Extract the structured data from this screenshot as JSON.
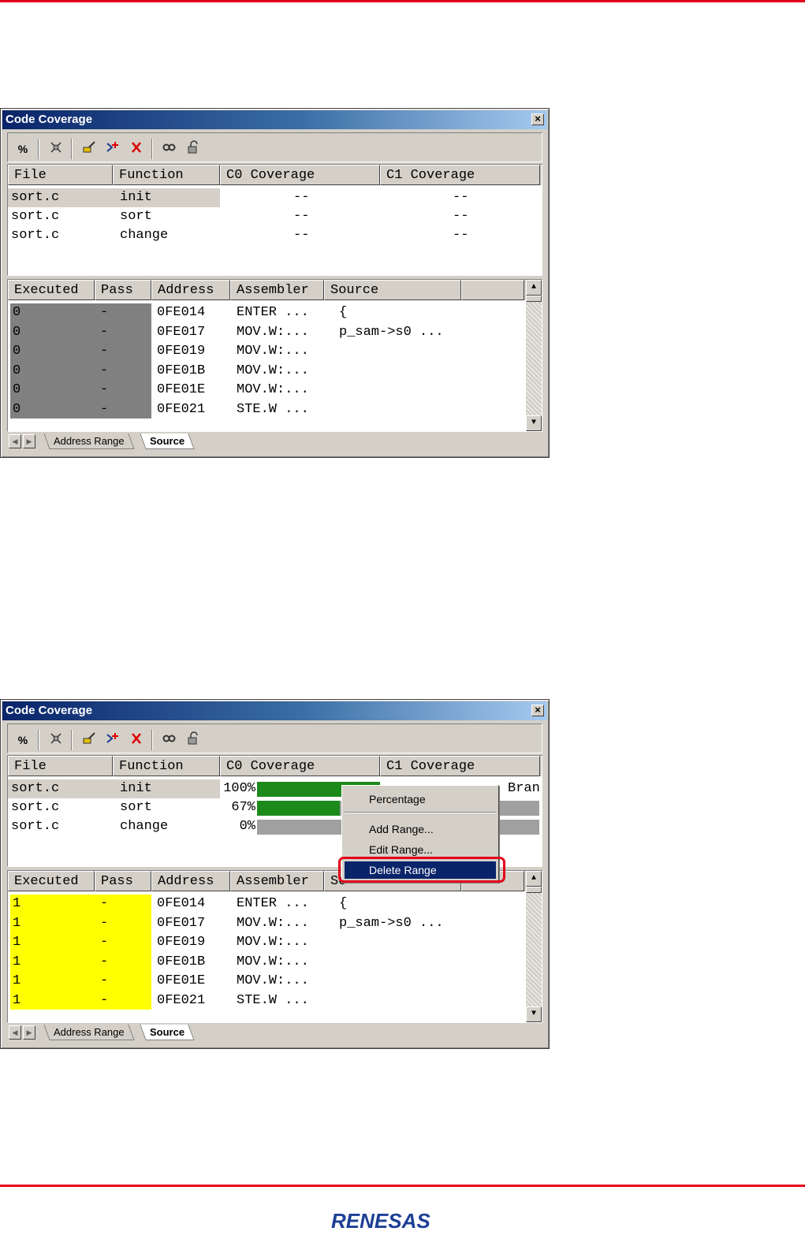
{
  "window": {
    "title": "Code Coverage"
  },
  "toolbar": {
    "percent_icon": "%",
    "icons": [
      "settings-icon",
      "brush-icon",
      "add-range-icon",
      "delete-range-icon",
      "find-icon",
      "refresh-icon"
    ]
  },
  "function_columns": [
    "File",
    "Function",
    "C0 Coverage",
    "C1 Coverage"
  ],
  "detail_columns": [
    "Executed",
    "Pass",
    "Address",
    "Assembler",
    "Source"
  ],
  "tabs": [
    "Address Range",
    "Source"
  ],
  "screen1": {
    "function_rows": [
      {
        "file": "sort.c",
        "function": "init",
        "c0": "--",
        "c1": "--"
      },
      {
        "file": "sort.c",
        "function": "sort",
        "c0": "--",
        "c1": "--"
      },
      {
        "file": "sort.c",
        "function": "change",
        "c0": "--",
        "c1": "--"
      }
    ],
    "detail_rows": [
      {
        "executed": "0",
        "pass": "-",
        "address": "0FE014",
        "assembler": "ENTER ...",
        "source": "{"
      },
      {
        "executed": "0",
        "pass": "-",
        "address": "0FE017",
        "assembler": "MOV.W:...",
        "source": "p_sam->s0 ..."
      },
      {
        "executed": "0",
        "pass": "-",
        "address": "0FE019",
        "assembler": "MOV.W:...",
        "source": ""
      },
      {
        "executed": "0",
        "pass": "-",
        "address": "0FE01B",
        "assembler": "MOV.W:...",
        "source": ""
      },
      {
        "executed": "0",
        "pass": "-",
        "address": "0FE01E",
        "assembler": "MOV.W:...",
        "source": ""
      },
      {
        "executed": "0",
        "pass": "-",
        "address": "0FE021",
        "assembler": "STE.W ...",
        "source": ""
      }
    ],
    "executed_color": "#808080"
  },
  "screen2": {
    "function_rows": [
      {
        "file": "sort.c",
        "function": "init",
        "c0_text": "100%",
        "c0_fraction": 1.0
      },
      {
        "file": "sort.c",
        "function": "sort",
        "c0_text": "67%",
        "c0_fraction": 0.67
      },
      {
        "file": "sort.c",
        "function": "change",
        "c0_text": "0%",
        "c0_fraction": 0.0
      }
    ],
    "c1_partial_text": "Bran",
    "detail_rows": [
      {
        "executed": "1",
        "pass": "-",
        "address": "0FE014",
        "assembler": "ENTER ...",
        "source": "{"
      },
      {
        "executed": "1",
        "pass": "-",
        "address": "0FE017",
        "assembler": "MOV.W:...",
        "source": "p_sam->s0 ..."
      },
      {
        "executed": "1",
        "pass": "-",
        "address": "0FE019",
        "assembler": "MOV.W:...",
        "source": ""
      },
      {
        "executed": "1",
        "pass": "-",
        "address": "0FE01B",
        "assembler": "MOV.W:...",
        "source": ""
      },
      {
        "executed": "1",
        "pass": "-",
        "address": "0FE01E",
        "assembler": "MOV.W:...",
        "source": ""
      },
      {
        "executed": "1",
        "pass": "-",
        "address": "0FE021",
        "assembler": "STE.W ...",
        "source": ""
      }
    ],
    "executed_color": "#ffff00",
    "context_menu": [
      "Percentage",
      "Add Range...",
      "Edit Range...",
      "Delete Range"
    ],
    "hidden_source_header": "So"
  },
  "colors": {
    "brand_red": "#e4001b",
    "coverage_green": "#1b8a1b",
    "menu_highlight": "#0a246a"
  },
  "logo": {
    "text": "RENESAS"
  }
}
